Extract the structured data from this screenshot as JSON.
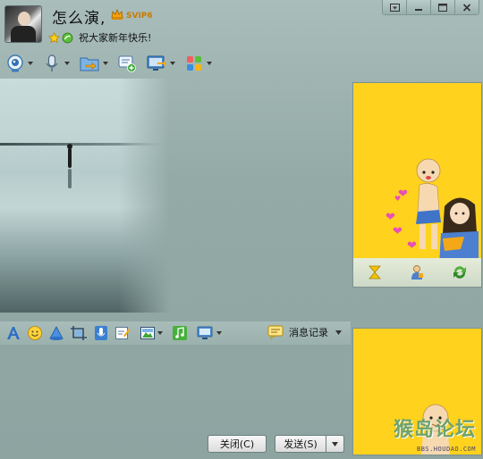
{
  "contact": {
    "name": "怎么演,",
    "vip_badge": "SVIP6",
    "signature": "祝大家新年快乐!"
  },
  "window_buttons": [
    "menu",
    "minimize",
    "maximize",
    "close"
  ],
  "toolbar": {
    "items": [
      {
        "icon": "webcam-icon",
        "has_dropdown": true
      },
      {
        "icon": "microphone-icon",
        "has_dropdown": true
      },
      {
        "icon": "send-file-icon",
        "has_dropdown": true
      },
      {
        "icon": "message-add-icon",
        "has_dropdown": false
      },
      {
        "icon": "remote-desktop-icon",
        "has_dropdown": true
      },
      {
        "icon": "apps-icon",
        "has_dropdown": true
      }
    ]
  },
  "input_toolbar": {
    "icons": [
      "font-icon",
      "emoticon-icon",
      "magic-icon",
      "screenshot-icon",
      "voice-message-icon",
      "scribble-icon",
      "image-icon",
      "music-icon",
      "screen-share-icon"
    ],
    "history_label": "消息记录"
  },
  "buttons": {
    "close_label": "关闭(C)",
    "send_label": "发送(S)"
  },
  "ad": {
    "watermark": "猴岛论坛",
    "watermark_url": "BBS.HOUDAO.COM"
  },
  "colors": {
    "window_bg": "#93aaa6",
    "ad_yellow": "#ffd21e",
    "vip_orange": "#c77b00"
  }
}
